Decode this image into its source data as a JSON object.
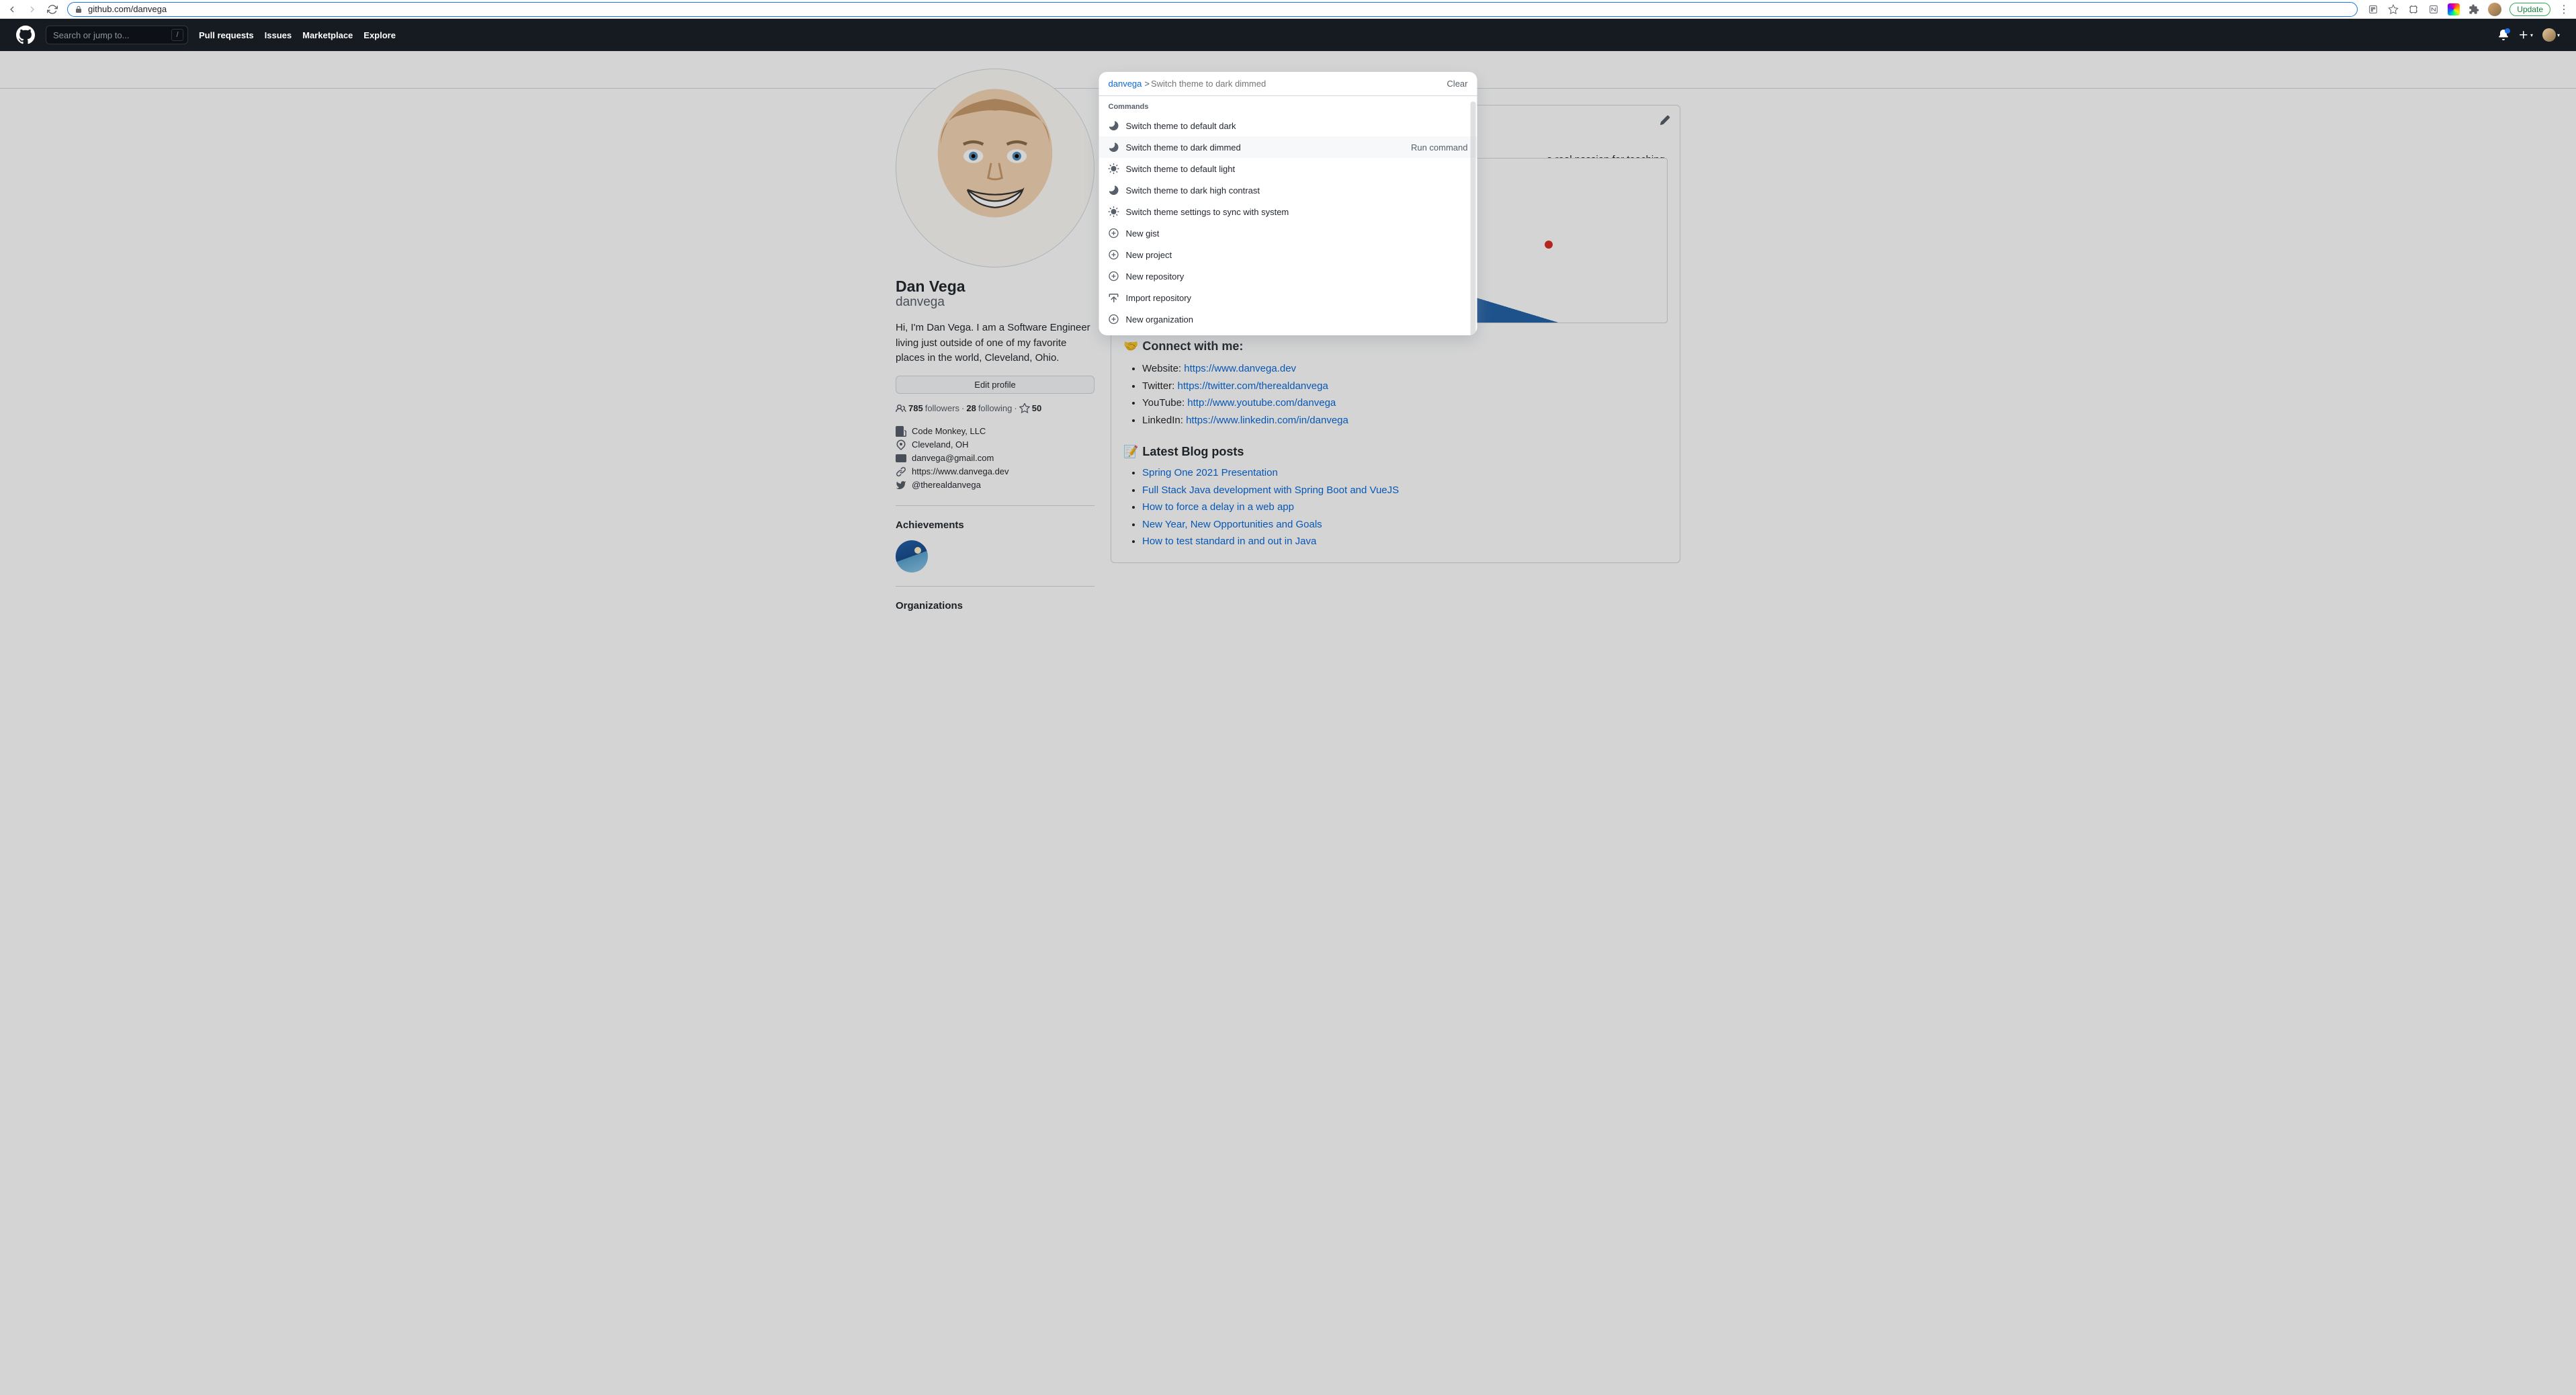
{
  "browser": {
    "url": "github.com/danvega",
    "update_label": "Update"
  },
  "gh_header": {
    "search_placeholder": "Search or jump to...",
    "nav": [
      "Pull requests",
      "Issues",
      "Marketplace",
      "Explore"
    ]
  },
  "palette": {
    "scope": "danvega",
    "placeholder": "Switch theme to dark dimmed",
    "clear_label": "Clear",
    "section_label": "Commands",
    "run_hint": "Run command",
    "items": [
      {
        "icon": "moon",
        "label": "Switch theme to default dark"
      },
      {
        "icon": "moon",
        "label": "Switch theme to dark dimmed",
        "highlighted": true
      },
      {
        "icon": "sun",
        "label": "Switch theme to default light"
      },
      {
        "icon": "moon",
        "label": "Switch theme to dark high contrast"
      },
      {
        "icon": "sun",
        "label": "Switch theme settings to sync with system"
      },
      {
        "icon": "plus",
        "label": "New gist"
      },
      {
        "icon": "plus",
        "label": "New project"
      },
      {
        "icon": "plus",
        "label": "New repository"
      },
      {
        "icon": "upload",
        "label": "Import repository"
      },
      {
        "icon": "plus",
        "label": "New organization"
      }
    ]
  },
  "profile": {
    "name": "Dan Vega",
    "login": "danvega",
    "bio": "Hi, I'm Dan Vega. I am a Software Engineer living just outside of one of my favorite places in the world, Cleveland, Ohio.",
    "edit_label": "Edit profile",
    "followers_count": "785",
    "followers_label": "followers",
    "following_count": "28",
    "following_label": "following",
    "stars_count": "50",
    "details": {
      "org": "Code Monkey, LLC",
      "location": "Cleveland, OH",
      "email": "danvega@gmail.com",
      "website": "https://www.danvega.dev",
      "twitter": "@therealdanvega"
    },
    "achievements_title": "Achievements",
    "organizations_title": "Organizations"
  },
  "readme": {
    "bio": "a real passion for teaching and I ing new.",
    "connect_title": "Connect with me:",
    "connect_emoji": "🤝",
    "connect": [
      {
        "label": "Website:",
        "url": "https://www.danvega.dev"
      },
      {
        "label": "Twitter:",
        "url": "https://twitter.com/therealdanvega"
      },
      {
        "label": "YouTube:",
        "url": "http://www.youtube.com/danvega"
      },
      {
        "label": "LinkedIn:",
        "url": "https://www.linkedin.com/in/danvega"
      }
    ],
    "blog_title": "Latest Blog posts",
    "blog_emoji": "📝",
    "posts": [
      "Spring One 2021 Presentation",
      "Full Stack Java development with Spring Boot and VueJS",
      "How to force a delay in a web app",
      "New Year, New Opportunities and Goals",
      "How to test standard in and out in Java"
    ]
  }
}
